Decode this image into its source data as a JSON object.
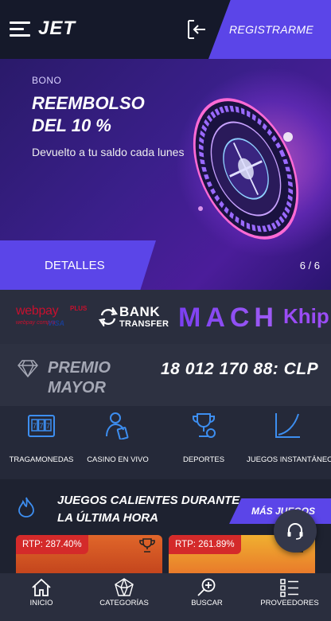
{
  "header": {
    "logo": "JET",
    "register_label": "REGISTRARME"
  },
  "hero": {
    "label": "BONO",
    "title": "REEMBOLSO\nDEL 10 %",
    "description": "Devuelto a tu saldo cada lunes",
    "details_label": "DETALLES",
    "pager": "6 / 6"
  },
  "payments": {
    "webpay": {
      "main": "webpay",
      "plus": "PLUS",
      "sub": "webpay compra",
      "cards": "VISA"
    },
    "bank": {
      "word": "BANK",
      "sub": "TRANSFER"
    },
    "mach": "MACH",
    "khip": "Khip"
  },
  "jackpot": {
    "title": "PREMIO\nMAYOR",
    "amount": "18 012 170 88: CLP"
  },
  "categories": [
    {
      "label": "TRAGAMONEDAS",
      "icon": "slot-machine-icon"
    },
    {
      "label": "CASINO EN VIVO",
      "icon": "live-dealer-icon"
    },
    {
      "label": "DEPORTES",
      "icon": "sports-trophy-icon"
    },
    {
      "label": "JUEGOS INSTANTÁNEOS",
      "icon": "instant-chart-icon"
    }
  ],
  "hot": {
    "title": "JUEGOS CALIENTES DURANTE\nLA ÚLTIMA HORA",
    "more_label": "MÁS JUEGOS",
    "games": [
      {
        "rtp": "RTP: 287.40%"
      },
      {
        "rtp": "RTP: 261.89%"
      }
    ]
  },
  "nav": [
    {
      "label": "INICIO",
      "icon": "home-icon"
    },
    {
      "label": "CATEGORÍAS",
      "icon": "categories-icon"
    },
    {
      "label": "BUSCAR",
      "icon": "search-icon"
    },
    {
      "label": "PROVEEDORES",
      "icon": "providers-icon"
    }
  ],
  "colors": {
    "accent": "#5b45e8",
    "background": "#1e2230",
    "rtp_badge": "#d42a2a"
  }
}
